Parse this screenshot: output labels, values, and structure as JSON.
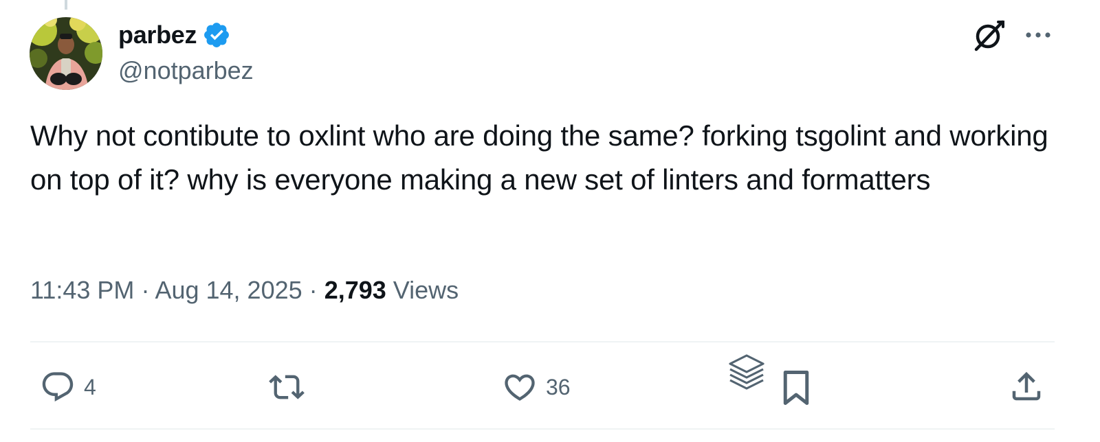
{
  "author": {
    "display_name": "parbez",
    "handle": "@notparbez",
    "verified": true
  },
  "tweet": {
    "text": "Why not contibute to oxlint who are doing the same? forking tsgolint and working on top of it? why is everyone making a new set of linters and formatters",
    "time": "11:43 PM",
    "date": "Aug 14, 2025",
    "separator": "·",
    "views_count": "2,793",
    "views_label": "Views"
  },
  "actions": {
    "replies": "4",
    "retweets": "",
    "likes": "36"
  },
  "icons": {
    "verified": "verified-badge-icon",
    "grok": "grok-icon",
    "more": "more-icon",
    "reply": "reply-icon",
    "retweet": "retweet-icon",
    "like": "heart-icon",
    "grok_analyze": "layers-icon",
    "bookmark": "bookmark-icon",
    "share": "share-icon"
  },
  "colors": {
    "text_primary": "#0f1419",
    "text_secondary": "#536471",
    "verified_blue": "#1d9bf0",
    "divider": "#eff3f4"
  }
}
